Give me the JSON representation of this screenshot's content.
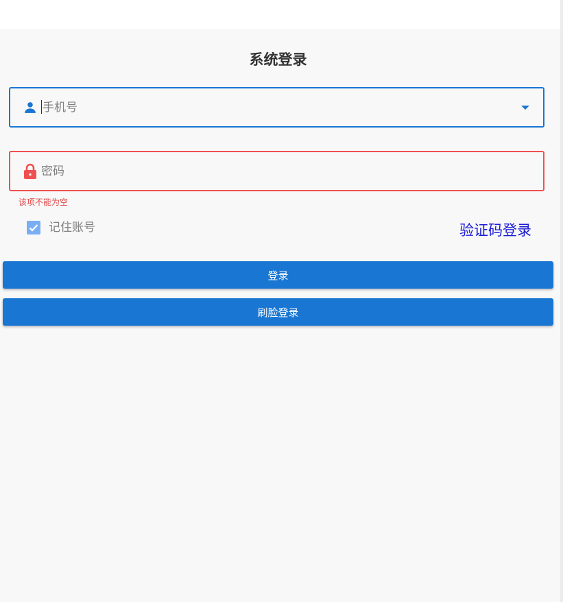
{
  "form": {
    "title": "系统登录",
    "phone": {
      "placeholder": "手机号",
      "icon": "person-icon",
      "dropdown_icon": "dropdown-arrow-icon"
    },
    "password": {
      "placeholder": "密码",
      "icon": "lock-icon",
      "error": "该项不能为空"
    },
    "remember": {
      "label": "记住账号",
      "checked": true
    },
    "sms_login_link": "验证码登录",
    "login_button": "登录",
    "face_login_button": "刷脸登录"
  },
  "colors": {
    "primary": "#1976d2",
    "error": "#f05050",
    "link": "#1a1ad6",
    "checkbox": "#7aaef3"
  }
}
